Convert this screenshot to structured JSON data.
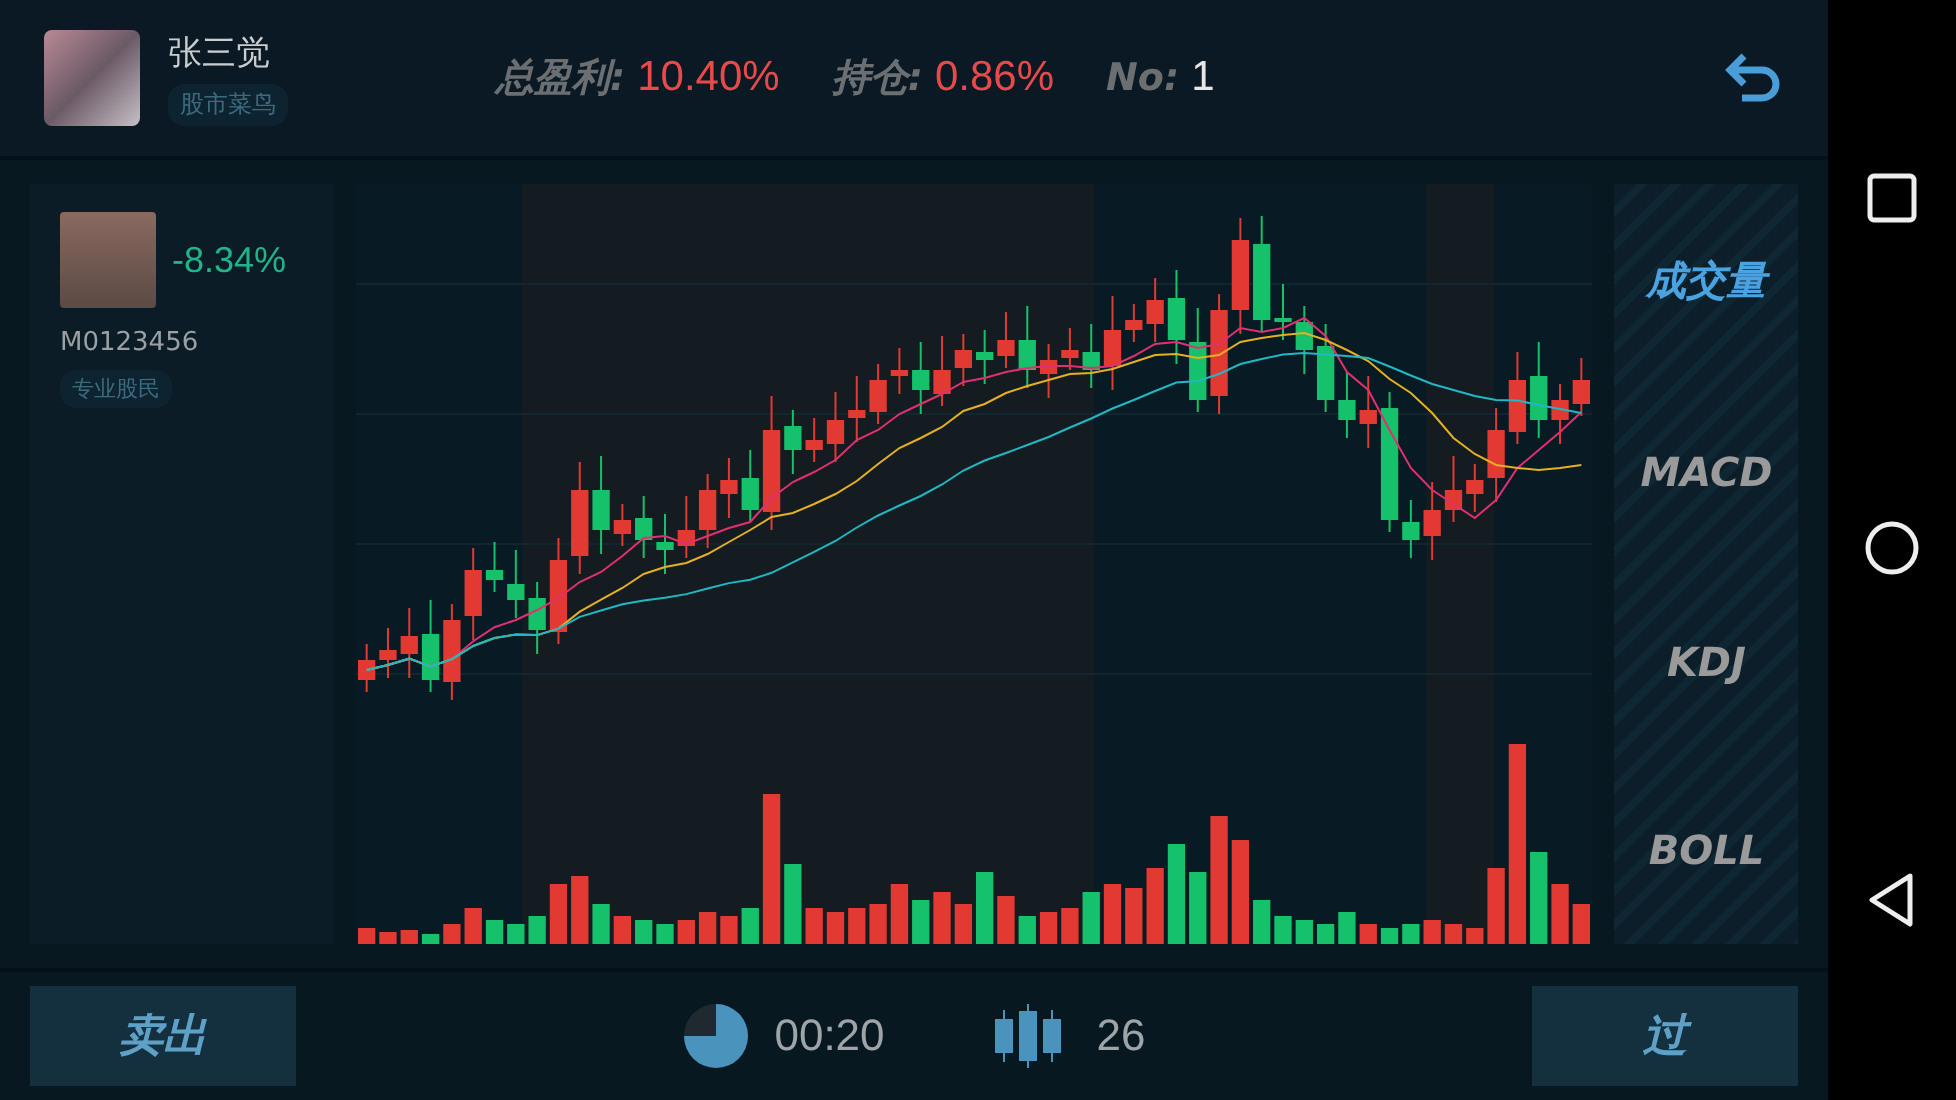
{
  "user": {
    "name": "张三觉",
    "badge": "股市菜鸟"
  },
  "stats": [
    {
      "label": "总盈利:",
      "value": "10.40%",
      "kind": "gain"
    },
    {
      "label": "持仓:",
      "value": "0.86%",
      "kind": "gain"
    },
    {
      "label": "No:",
      "value": "1",
      "kind": "plain"
    }
  ],
  "stock": {
    "change": "-8.34%",
    "code": "M0123456",
    "badge": "专业股民"
  },
  "indicator_tabs": [
    {
      "label": "成交量",
      "selected": true
    },
    {
      "label": "MACD",
      "selected": false
    },
    {
      "label": "KDJ",
      "selected": false
    },
    {
      "label": "BOLL",
      "selected": false
    }
  ],
  "footer": {
    "sell": "卖出",
    "time": "00:20",
    "count": "26",
    "pass": "过"
  }
}
